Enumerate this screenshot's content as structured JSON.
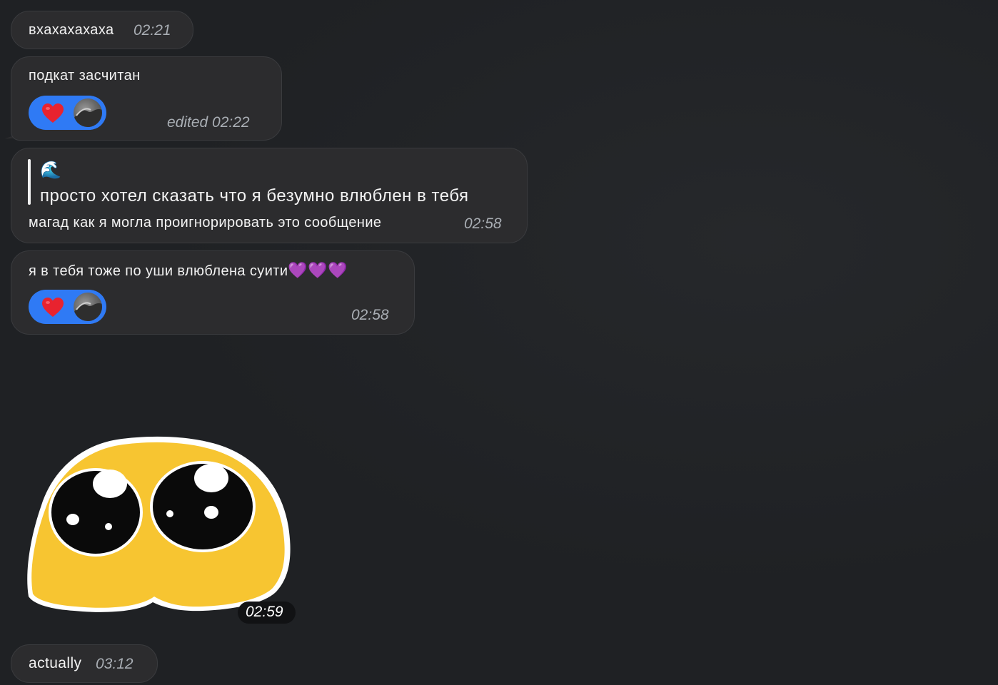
{
  "messages": [
    {
      "text": "вхахахахаха",
      "time": "02:21"
    },
    {
      "text": "подкат засчитан",
      "time": "edited 02:22",
      "reaction": {
        "emoji": "heart-red",
        "reactor": "avatar"
      }
    },
    {
      "reply": {
        "sender_emoji": "🌊",
        "quoted_text": "просто хотел сказать что я безумно влюблен в тебя"
      },
      "text": "магад как я могла проигнорировать это сообщение",
      "time": "02:58"
    },
    {
      "text": "я в тебя тоже по уши влюблена суити",
      "emojis": "💜💜💜",
      "time": "02:58",
      "reaction": {
        "emoji": "heart-red",
        "reactor": "avatar"
      }
    },
    {
      "sticker": "pleading-face-sticker",
      "time": "02:59"
    },
    {
      "text": "actually",
      "time": "03:12"
    }
  ],
  "colors": {
    "background": "#1f2124",
    "bubble": "#2c2c2e",
    "reaction": "#2f7af5",
    "timestamp": "#a9aeb4"
  }
}
